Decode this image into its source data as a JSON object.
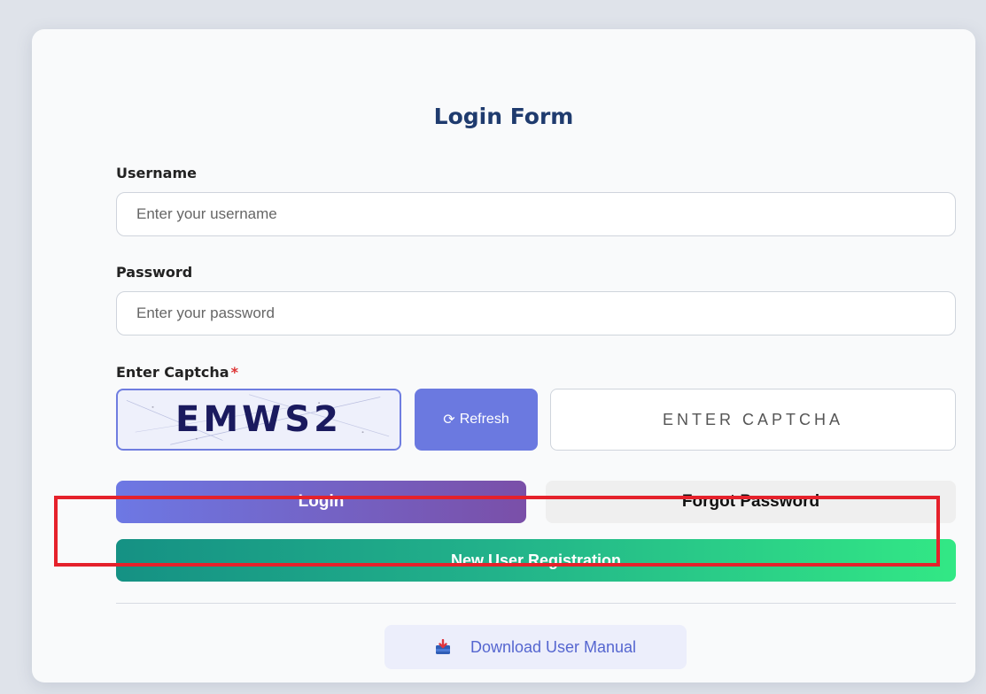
{
  "form": {
    "title": "Login Form",
    "username_label": "Username",
    "username_placeholder": "Enter your username",
    "password_label": "Password",
    "password_placeholder": "Enter your password",
    "captcha_label": "Enter Captcha",
    "captcha_required_mark": "*",
    "captcha_code": "EMWS2",
    "refresh_icon": "⟳",
    "refresh_label": "Refresh",
    "captcha_placeholder": "ENTER CAPTCHA",
    "login_label": "Login",
    "forgot_label": "Forgot Password",
    "register_label": "New User Registration",
    "manual_icon": "download-book-icon",
    "manual_label": "Download User Manual"
  },
  "colors": {
    "title": "#1f3b6e",
    "primary": "#6b79e0",
    "register_gradient_start": "#159184",
    "register_gradient_end": "#32e885",
    "highlight": "#e5212b"
  }
}
